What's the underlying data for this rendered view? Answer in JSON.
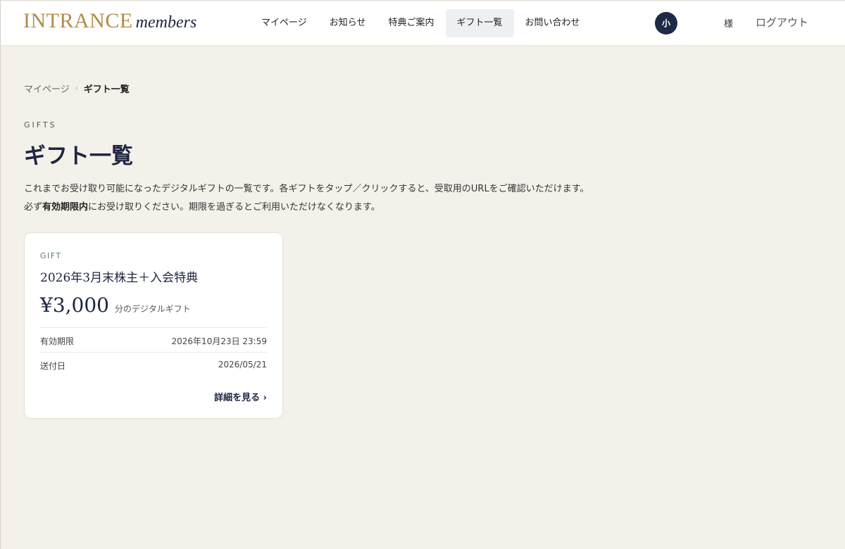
{
  "header": {
    "logo_main": "INTRANCE",
    "logo_sub": "members",
    "nav": [
      {
        "label": "マイページ",
        "active": false
      },
      {
        "label": "お知らせ",
        "active": false
      },
      {
        "label": "特典ご案内",
        "active": false
      },
      {
        "label": "ギフト一覧",
        "active": true
      },
      {
        "label": "お問い合わせ",
        "active": false
      }
    ],
    "avatar_initial": "小",
    "user_suffix": "様",
    "logout_label": "ログアウト"
  },
  "breadcrumb": {
    "parent": "マイページ",
    "separator": "›",
    "current": "ギフト一覧"
  },
  "page": {
    "eyebrow": "GIFTS",
    "title": "ギフト一覧",
    "desc_line1": "これまでお受け取り可能になったデジタルギフトの一覧です。各ギフトをタップ／クリックすると、受取用のURLをご確認いただけます。",
    "desc_line2_prefix": "必ず",
    "desc_line2_strong": "有効期限内",
    "desc_line2_suffix": "にお受け取りください。期限を過ぎるとご利用いただけなくなります。"
  },
  "gifts": [
    {
      "eyebrow": "GIFT",
      "title": "2026年3月末株主＋入会特典",
      "amount": "¥3,000",
      "amount_suffix": "分のデジタルギフト",
      "expiry_label": "有効期限",
      "expiry_value": "2026年10月23日 23:59",
      "sent_label": "送付日",
      "sent_value": "2026/05/21",
      "detail_label": "詳細を見る ›"
    }
  ],
  "colors": {
    "background": "#f4f1ea",
    "logo_gold": "#b08d4a",
    "navy": "#1e2540",
    "nav_active_bg": "#eef0f4"
  }
}
